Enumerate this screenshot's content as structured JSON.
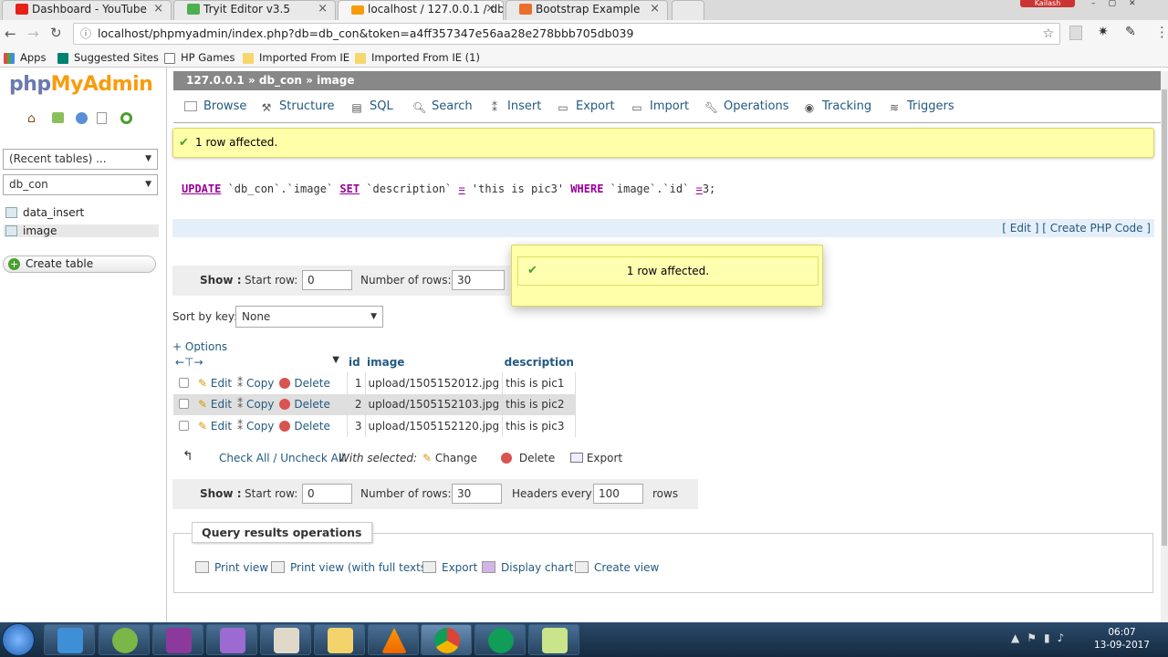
{
  "browser": {
    "tabs": [
      {
        "title": "Dashboard - YouTube",
        "icon": "youtube-icon",
        "color": "#e62117"
      },
      {
        "title": "Tryit Editor v3.5",
        "icon": "w3schools-icon",
        "color": "#4caf50"
      },
      {
        "title": "localhost / 127.0.0.1 / db",
        "icon": "phpmyadmin-icon",
        "color": "#f89c0e"
      },
      {
        "title": "Bootstrap Example",
        "icon": "w3schools-icon",
        "color": "#e8702a"
      }
    ],
    "user_badge": "Kailash",
    "url": "localhost/phpmyadmin/index.php?db=db_con&token=a4ff357347e56aa28e278bbb705db039",
    "bookmarks": [
      "Apps",
      "Suggested Sites",
      "HP Games",
      "Imported From IE",
      "Imported From IE (1)"
    ]
  },
  "nav": {
    "logo_php": "php",
    "logo_my": "MyAdmin",
    "recent": "(Recent tables) ...",
    "db": "db_con",
    "tables": [
      "data_insert",
      "image"
    ],
    "create_table": "Create table"
  },
  "main": {
    "breadcrumb": "127.0.0.1 » db_con » image",
    "tabs": [
      "Browse",
      "Structure",
      "SQL",
      "Search",
      "Insert",
      "Export",
      "Import",
      "Operations",
      "Tracking",
      "Triggers"
    ],
    "message": "1 row affected.",
    "sql": {
      "update": "UPDATE",
      "target": " `db_con`.`image` ",
      "set": "SET",
      "col": " `description` ",
      "eq": "=",
      "val": " 'this is pic3' ",
      "where": "WHERE",
      "cond": " `image`.`id` ",
      "eq2": "=",
      "end": "3;"
    },
    "sql_links": "[ Edit ] [ Create PHP Code ]",
    "notification": "1 row affected.",
    "show_label": "Show :",
    "start_row_label": "Start row:",
    "start_row": "0",
    "num_rows_label": "Number of rows:",
    "num_rows": "30",
    "sort_label": "Sort by key:",
    "sort_value": "None",
    "options": "+ Options",
    "columns": [
      "id",
      "image",
      "description"
    ],
    "rows": [
      {
        "id": "1",
        "image": "upload/1505152012.jpg",
        "description": "this is pic1"
      },
      {
        "id": "2",
        "image": "upload/1505152103.jpg",
        "description": "this is pic2"
      },
      {
        "id": "3",
        "image": "upload/1505152120.jpg",
        "description": "this is pic3"
      }
    ],
    "row_actions": {
      "edit": "Edit",
      "copy": "Copy",
      "delete": "Delete"
    },
    "check_all": "Check All / Uncheck All",
    "with_selected": "With selected:",
    "bulk": {
      "change": "Change",
      "delete": "Delete",
      "export": "Export"
    },
    "start_row2": "0",
    "num_rows2": "30",
    "headers_every_label": "Headers every",
    "headers_every": "100",
    "rows_label": "rows",
    "qro_title": "Query results operations",
    "qro_links": [
      "Print view",
      "Print view (with full texts)",
      "Export",
      "Display chart",
      "Create view"
    ]
  },
  "taskbar": {
    "time": "06:07",
    "date": "13-09-2017"
  }
}
